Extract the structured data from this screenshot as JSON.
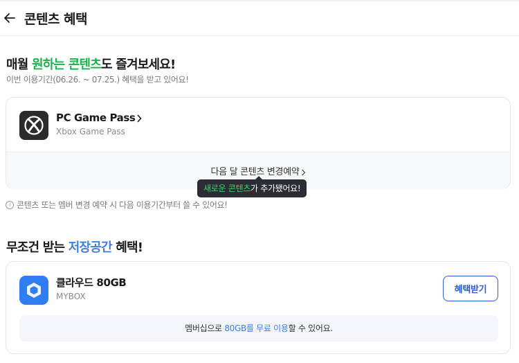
{
  "header": {
    "title": "콘텐츠 혜택"
  },
  "monthly": {
    "title_pre": "매월 ",
    "title_hl": "원하는 콘텐츠",
    "title_post": "도 즐겨보세요!",
    "period": "이번 이용기간(06.26. ~ 07.25.) 혜택을 받고 있어요!",
    "item": {
      "name": "PC Game Pass",
      "sub": "Xbox Game Pass",
      "icon": "xbox-icon"
    },
    "reserve_label": "다음 달 콘텐츠 변경예약",
    "tooltip": {
      "hl": "새로운 콘텐츠",
      "rest": "가 추가됐어요!"
    },
    "notice": "콘텐츠 또는 멤버 변경 예약 시 다음 이용기간부터 쓸 수 있어요!"
  },
  "storage": {
    "title_pre": "무조건 받는 ",
    "title_hl": "저장공간",
    "title_post": " 혜택!",
    "item": {
      "name": "클라우드 80GB",
      "sub": "MYBOX",
      "icon": "mybox-cube-icon"
    },
    "button_label": "혜택받기",
    "note": {
      "pre": "멤버십으로 ",
      "hl": "80GB를 무료 이용",
      "post": "할 수 있어요."
    }
  },
  "colors": {
    "green": "#19b34b",
    "blue": "#3f7fe0",
    "button": "#2e5bd6",
    "mybox": "#2f7df0"
  }
}
